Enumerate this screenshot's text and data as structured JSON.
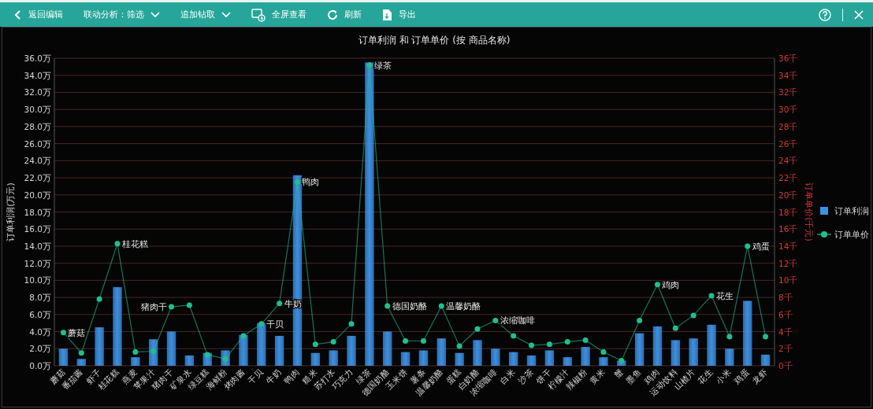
{
  "toolbar": {
    "items": [
      {
        "kind": "back",
        "label": "返回编辑"
      },
      {
        "kind": "dropdown",
        "label": "联动分析：筛选"
      },
      {
        "kind": "dropdown",
        "label": "追加钻取"
      },
      {
        "kind": "fullscreen",
        "label": "全屏查看"
      },
      {
        "kind": "refresh",
        "label": "刷新"
      },
      {
        "kind": "export",
        "label": "导出"
      }
    ]
  },
  "chart": {
    "chart_data": {
      "type": "bar",
      "title": "订单利润 和 订单单价 (按 商品名称)",
      "ylabel": "订单利润(万元)",
      "y2label": "订单单价(千元)",
      "categories": [
        "蘑菇",
        "番茄酱",
        "虾子",
        "桂花糕",
        "燕麦",
        "苹果汁",
        "猪肉干",
        "矿泉水",
        "绿豆糕",
        "海鲜粉",
        "烤肉酱",
        "干贝",
        "牛奶",
        "鸭肉",
        "糙米",
        "苏打水",
        "巧克力",
        "绿茶",
        "德国奶酪",
        "玉米饼",
        "薯条",
        "温馨奶酪",
        "蛋糕",
        "白奶酪",
        "浓缩咖啡",
        "白米",
        "沙茶",
        "饼干",
        "柠檬汁",
        "辣椒粉",
        "黄米",
        "蟹",
        "墨鱼",
        "鸡肉",
        "运动饮料",
        "山楂片",
        "花生",
        "小米",
        "鸡蛋",
        "龙虾"
      ],
      "series": [
        {
          "name": "订单利润",
          "type": "bar",
          "color": "#3d8fe0",
          "values": [
            2.0,
            0.8,
            4.5,
            9.2,
            1.0,
            3.1,
            4.0,
            1.2,
            1.5,
            1.8,
            3.6,
            5.0,
            3.5,
            22.3,
            1.5,
            1.8,
            3.5,
            35.5,
            4.0,
            1.6,
            1.8,
            3.2,
            1.5,
            3.0,
            2.0,
            1.6,
            1.2,
            1.8,
            1.0,
            2.2,
            1.0,
            0.6,
            3.8,
            4.6,
            3.0,
            3.2,
            4.8,
            2.0,
            7.6,
            1.3
          ]
        },
        {
          "name": "订单单价",
          "type": "line",
          "color": "#1fbf8f",
          "marker": "circle",
          "values": [
            3.9,
            1.5,
            7.8,
            14.3,
            1.6,
            1.7,
            6.9,
            7.1,
            1.3,
            0.8,
            3.5,
            4.9,
            7.3,
            21.5,
            2.5,
            2.8,
            4.9,
            35.2,
            7.0,
            2.9,
            2.9,
            7.0,
            2.3,
            4.3,
            5.3,
            3.5,
            2.4,
            2.5,
            2.8,
            3.0,
            1.6,
            0.6,
            5.3,
            9.5,
            4.4,
            5.9,
            8.2,
            3.4,
            14.0,
            3.4
          ]
        }
      ],
      "ylim": [
        0,
        36
      ],
      "yticks": [
        {
          "value": 0,
          "label": "0.0万"
        },
        {
          "value": 2,
          "label": "2.0万"
        },
        {
          "value": 4,
          "label": "4.0万"
        },
        {
          "value": 6,
          "label": "6.0万"
        },
        {
          "value": 8,
          "label": "8.0万"
        },
        {
          "value": 10,
          "label": "10.0万"
        },
        {
          "value": 12,
          "label": "12.0万"
        },
        {
          "value": 14,
          "label": "14.0万"
        },
        {
          "value": 16,
          "label": "16.0万"
        },
        {
          "value": 18,
          "label": "18.0万"
        },
        {
          "value": 20,
          "label": "20.0万"
        },
        {
          "value": 22,
          "label": "22.0万"
        },
        {
          "value": 24,
          "label": "24.0万"
        },
        {
          "value": 26,
          "label": "26.0万"
        },
        {
          "value": 28,
          "label": "28.0万"
        },
        {
          "value": 30,
          "label": "30.0万"
        },
        {
          "value": 32,
          "label": "32.0万"
        },
        {
          "value": 34,
          "label": "34.0万"
        },
        {
          "value": 36,
          "label": "36.0万"
        }
      ],
      "y2ticks": [
        {
          "value": 0,
          "label": "0千"
        },
        {
          "value": 2,
          "label": "2千"
        },
        {
          "value": 4,
          "label": "4千"
        },
        {
          "value": 6,
          "label": "6千"
        },
        {
          "value": 8,
          "label": "8千"
        },
        {
          "value": 10,
          "label": "10千"
        },
        {
          "value": 12,
          "label": "12千"
        },
        {
          "value": 14,
          "label": "14千"
        },
        {
          "value": 16,
          "label": "16千"
        },
        {
          "value": 18,
          "label": "18千"
        },
        {
          "value": 20,
          "label": "20千"
        },
        {
          "value": 22,
          "label": "22千"
        },
        {
          "value": 24,
          "label": "24千"
        },
        {
          "value": 26,
          "label": "26千"
        },
        {
          "value": 28,
          "label": "28千"
        },
        {
          "value": 30,
          "label": "30千"
        },
        {
          "value": 32,
          "label": "32千"
        },
        {
          "value": 34,
          "label": "34千"
        },
        {
          "value": 36,
          "label": "36千"
        }
      ],
      "annotations": [
        {
          "x": "蘑菇",
          "text": "蘑菇"
        },
        {
          "x": "桂花糕",
          "text": "桂花糕"
        },
        {
          "x": "猪肉干",
          "text": "猪肉干"
        },
        {
          "x": "干贝",
          "text": "干贝"
        },
        {
          "x": "牛奶",
          "text": "牛奶"
        },
        {
          "x": "鸭肉",
          "text": "鸭肉"
        },
        {
          "x": "绿茶",
          "text": "绿茶"
        },
        {
          "x": "德国奶酪",
          "text": "德国奶酪"
        },
        {
          "x": "温馨奶酪",
          "text": "温馨奶酪"
        },
        {
          "x": "浓缩咖啡",
          "text": "浓缩咖啡"
        },
        {
          "x": "鸡肉",
          "text": "鸡肉"
        },
        {
          "x": "花生",
          "text": "花生"
        },
        {
          "x": "鸡蛋",
          "text": "鸡蛋"
        }
      ],
      "y2lim": [
        0,
        36
      ],
      "grid": true,
      "legend": true
    }
  }
}
